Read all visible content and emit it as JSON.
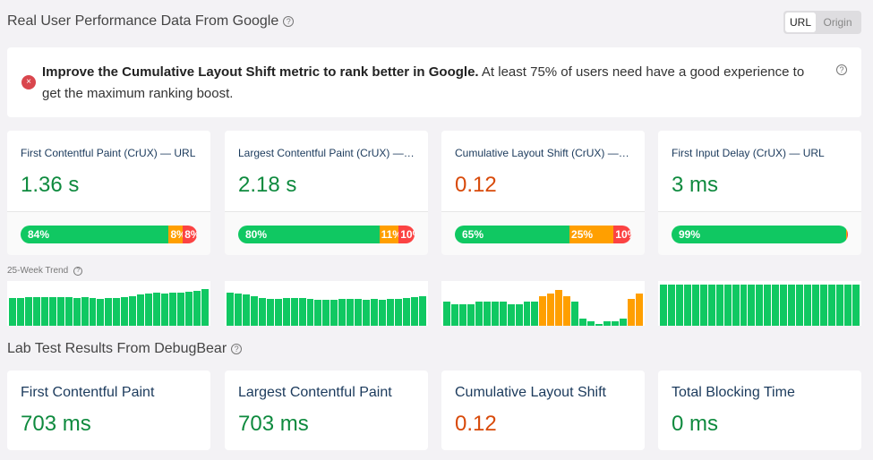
{
  "rum": {
    "title": "Real User Performance Data From Google",
    "toggle": [
      "URL",
      "Origin"
    ],
    "selected": "URL"
  },
  "alert": {
    "bold": "Improve the Cumulative Layout Shift metric to rank better in Google.",
    "text": " At least 75% of users need have a good experience to get the maximum ranking boost."
  },
  "colors": {
    "good": "#0e8a3e",
    "needs_improvement": "#d84a0a",
    "bar_good": "#10c862",
    "bar_ni": "#ff9f00",
    "bar_poor": "#fb4343"
  },
  "crux": [
    {
      "title": "First Contentful Paint (CrUX) — URL",
      "value": "1.36 s",
      "status": "good",
      "dist": [
        84,
        8,
        8
      ],
      "labels": [
        "84%",
        "8%",
        "8%"
      ],
      "trend": [
        31,
        31,
        32,
        32,
        32,
        32,
        32,
        32,
        31,
        32,
        31,
        30,
        31,
        31,
        32,
        33,
        35,
        36,
        37,
        36,
        37,
        37,
        38,
        39,
        41
      ],
      "trend_status": [
        "g"
      ]
    },
    {
      "title": "Largest Contentful Paint (CrUX) — URL",
      "value": "2.18 s",
      "status": "good",
      "dist": [
        80,
        11,
        10
      ],
      "labels": [
        "80%",
        "11%",
        "10%"
      ],
      "trend": [
        37,
        36,
        35,
        33,
        31,
        30,
        30,
        31,
        31,
        31,
        30,
        29,
        29,
        29,
        30,
        30,
        30,
        29,
        30,
        29,
        30,
        30,
        31,
        32,
        33
      ]
    },
    {
      "title": "Cumulative Layout Shift (CrUX) — URL",
      "value": "0.12",
      "status": "needs_improvement",
      "dist": [
        65,
        25,
        10
      ],
      "labels": [
        "65%",
        "25%",
        "10%"
      ],
      "trend": [
        27,
        24,
        24,
        24,
        27,
        27,
        27,
        27,
        24,
        24,
        27,
        27,
        33,
        36,
        40,
        33,
        27,
        8,
        5,
        2,
        5,
        5,
        8,
        30,
        36
      ],
      "trend_orange": [
        12,
        13,
        14,
        15,
        23,
        24
      ]
    },
    {
      "title": "First Input Delay (CrUX) — URL",
      "value": "3 ms",
      "status": "good",
      "dist": [
        99,
        0.5,
        0.5
      ],
      "labels": [
        "99%",
        "",
        ""
      ],
      "trend": [
        46,
        46,
        46,
        46,
        46,
        46,
        46,
        46,
        46,
        46,
        46,
        46,
        46,
        46,
        46,
        46,
        46,
        46,
        46,
        46,
        46,
        46,
        46,
        46,
        46
      ]
    }
  ],
  "trend_label": "25-Week Trend",
  "lab": {
    "title": "Lab Test Results From DebugBear",
    "items": [
      {
        "title": "First Contentful Paint",
        "value": "703 ms",
        "status": "good"
      },
      {
        "title": "Largest Contentful Paint",
        "value": "703 ms",
        "status": "good"
      },
      {
        "title": "Cumulative Layout Shift",
        "value": "0.12",
        "status": "needs_improvement"
      },
      {
        "title": "Total Blocking Time",
        "value": "0 ms",
        "status": "good"
      }
    ]
  }
}
